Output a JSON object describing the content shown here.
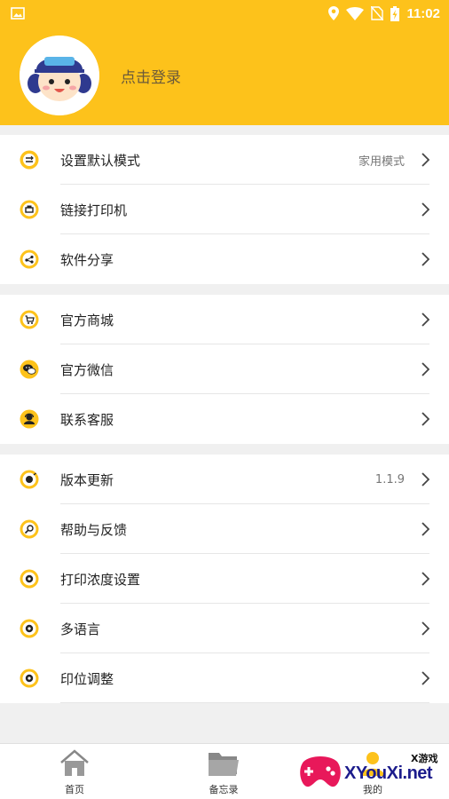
{
  "status_bar": {
    "time": "11:02"
  },
  "header": {
    "login_text": "点击登录"
  },
  "group1": [
    {
      "label": "设置默认模式",
      "value": "家用模式",
      "icon": "mode-icon"
    },
    {
      "label": "链接打印机",
      "value": "",
      "icon": "printer-icon"
    },
    {
      "label": "软件分享",
      "value": "",
      "icon": "share-icon"
    }
  ],
  "group2": [
    {
      "label": "官方商城",
      "value": "",
      "icon": "cart-icon"
    },
    {
      "label": "官方微信",
      "value": "",
      "icon": "wechat-icon"
    },
    {
      "label": "联系客服",
      "value": "",
      "icon": "customer-service-icon"
    }
  ],
  "group3": [
    {
      "label": "版本更新",
      "value": "1.1.9",
      "icon": "update-icon"
    },
    {
      "label": "帮助与反馈",
      "value": "",
      "icon": "help-icon"
    },
    {
      "label": "打印浓度设置",
      "value": "",
      "icon": "density-icon"
    },
    {
      "label": "多语言",
      "value": "",
      "icon": "language-icon"
    },
    {
      "label": "印位调整",
      "value": "",
      "icon": "position-icon"
    }
  ],
  "tabs": [
    {
      "label": "首页",
      "icon": "home-icon"
    },
    {
      "label": "备忘录",
      "icon": "folder-icon"
    },
    {
      "label": "我的",
      "icon": "profile-icon"
    }
  ],
  "watermark": {
    "text": "XYouXi.net",
    "sub": "X游戏"
  },
  "colors": {
    "accent": "#fdc21b",
    "background": "#f0f0f0"
  }
}
